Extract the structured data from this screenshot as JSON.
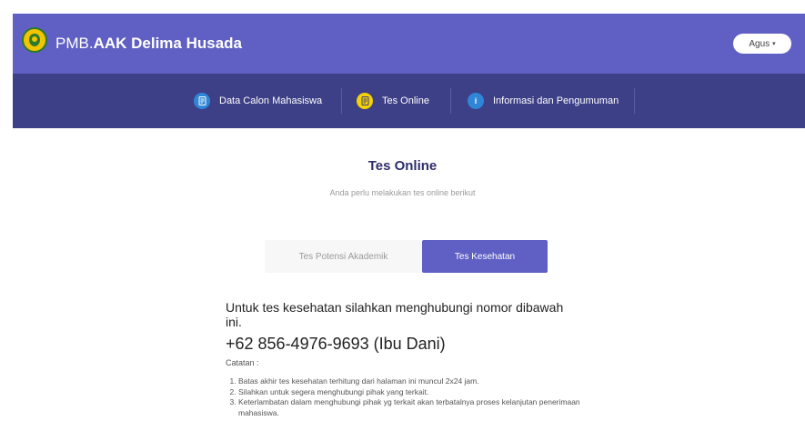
{
  "header": {
    "brand_prefix": "PMB.",
    "brand_name": "AAK Delima Husada",
    "user_name": "Agus",
    "caret": "▾"
  },
  "nav": {
    "items": [
      {
        "label": "Data Calon Mahasiswa",
        "icon": "form-icon",
        "icon_color": "#2f86d6"
      },
      {
        "label": "Tes Online",
        "icon": "exam-icon",
        "icon_color": "#f5d200"
      },
      {
        "label": "Informasi dan Pengumuman",
        "icon": "info-icon",
        "icon_color": "#2f86d6"
      }
    ]
  },
  "page": {
    "title": "Tes Online",
    "subtitle": "Anda perlu melakukan tes online berikut"
  },
  "tabs": {
    "inactive_label": "Tes Potensi Akademik",
    "active_label": "Tes Kesehatan"
  },
  "content": {
    "heading": "Untuk tes kesehatan silahkan menghubungi nomor dibawah ini.",
    "phone": "+62 856-4976-9693 (Ibu Dani)",
    "note_label": "Catatan :",
    "notes": [
      "Batas akhir tes kesehatan terhitung dari halaman ini muncul 2x24 jam.",
      "Silahkan untuk segera menghubungi pihak yang terkait.",
      "Keterlambatan dalam menghubungi pihak yg terkait akan terbatalnya proses kelanjutan penerimaan mahasiswa."
    ]
  },
  "colors": {
    "topbar": "#5f5fc4",
    "navbar": "#3d3f87",
    "accent": "#5f5fc4"
  }
}
